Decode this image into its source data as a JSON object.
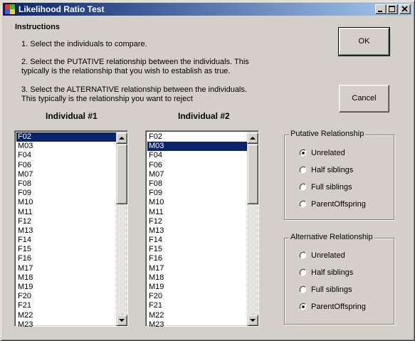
{
  "window": {
    "title": "Likelihood Ratio Test"
  },
  "titlebar_buttons": {
    "minimize": "_",
    "maximize": "□",
    "close": "×"
  },
  "instructions": {
    "heading": "Instructions",
    "step1": "1. Select the individuals to compare.",
    "step2_line1": "2. Select the PUTATIVE relationship between the individuals. This",
    "step2_line2": "typically is the relationship that you wish to establish as true.",
    "step3_line1": "3. Select the ALTERNATIVE relationship between the individuals.",
    "step3_line2": "This typically is the relationship you want to reject"
  },
  "buttons": {
    "ok": "OK",
    "cancel": "Cancel"
  },
  "individual1": {
    "heading": "Individual #1",
    "items": [
      "F02",
      "M03",
      "F04",
      "F06",
      "M07",
      "F08",
      "F09",
      "M10",
      "M11",
      "F12",
      "M13",
      "F14",
      "F15",
      "F16",
      "M17",
      "M18",
      "M19",
      "F20",
      "F21",
      "M22",
      "M23"
    ],
    "selected": "F02"
  },
  "individual2": {
    "heading": "Individual #2",
    "items": [
      "F02",
      "M03",
      "F04",
      "F06",
      "M07",
      "F08",
      "F09",
      "M10",
      "M11",
      "F12",
      "M13",
      "F14",
      "F15",
      "F16",
      "M17",
      "M18",
      "M19",
      "F20",
      "F21",
      "M22",
      "M23"
    ],
    "selected": "M03"
  },
  "putative": {
    "legend": "Putative Relationship",
    "options": [
      "Unrelated",
      "Half siblings",
      "Full siblings",
      "ParentOffspring"
    ],
    "selected": "Unrelated"
  },
  "alternative": {
    "legend": "Alternative Relationship",
    "options": [
      "Unrelated",
      "Half siblings",
      "Full siblings",
      "ParentOffspring"
    ],
    "selected": "ParentOffspring"
  },
  "colors": {
    "window_bg": "#d4d0c8",
    "titlebar_start": "#0a246a",
    "titlebar_end": "#a6caf0",
    "selection": "#0a246a"
  },
  "icons": {
    "app": "app-window-icon",
    "minimize": "minimize-icon",
    "maximize": "maximize-icon",
    "close": "close-icon",
    "scroll_up": "chevron-up-icon",
    "scroll_down": "chevron-down-icon"
  }
}
